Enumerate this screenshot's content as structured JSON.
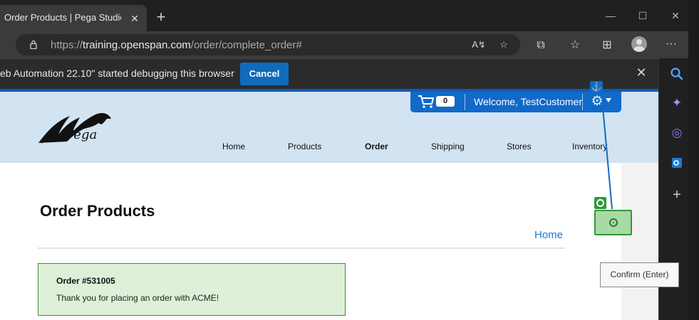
{
  "browser": {
    "tab_title": "Order Products | Pega Studio Tra",
    "tab_close": "✕",
    "new_tab": "+",
    "window": {
      "minimize": "—",
      "maximize": "☐",
      "close": "✕"
    },
    "url_prefix": "https://",
    "url_host": "training.openspan.com",
    "url_path": "/order/complete_order#",
    "toolbar_icons": [
      "read-aloud-icon",
      "favorite-add-icon",
      "extensions-icon",
      "favorites-icon",
      "collections-icon",
      "profile-icon",
      "more-icon"
    ],
    "more_label": "···"
  },
  "infobar": {
    "message": "eb Automation 22.10\" started debugging this browser",
    "cancel_label": "Cancel",
    "close": "✕"
  },
  "sidebar": {
    "icons": [
      "search-icon",
      "copilot-icon",
      "office-icon",
      "outlook-icon",
      "add-icon"
    ],
    "add": "+"
  },
  "site": {
    "logo_text": "Pega",
    "cart_count": "0",
    "welcome": "Welcome, TestCustomer",
    "nav": [
      {
        "label": "Home",
        "active": false
      },
      {
        "label": "Products",
        "active": false
      },
      {
        "label": "Order",
        "active": true
      },
      {
        "label": "Shipping",
        "active": false
      },
      {
        "label": "Stores",
        "active": false
      },
      {
        "label": "Inventory",
        "active": false
      }
    ],
    "heading": "Order Products",
    "breadcrumb_home": "Home",
    "order_number": "Order #531005",
    "thanks": "Thank you for placing an order with ACME!"
  },
  "overlay": {
    "tooltip": "Confirm (Enter)",
    "colors": {
      "anchor": "#1169c9",
      "target": "#2f9a3a"
    }
  }
}
